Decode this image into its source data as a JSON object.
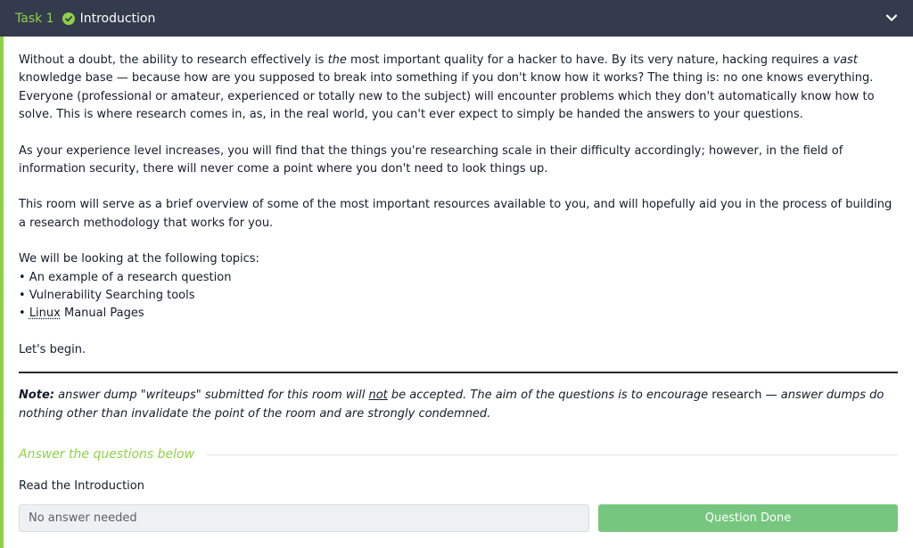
{
  "header": {
    "task_label": "Task 1",
    "title": "Introduction",
    "colors": {
      "bg": "#343b4d",
      "accent": "#8fd14a"
    },
    "icons": [
      "check-circle-icon",
      "chevron-down-icon"
    ]
  },
  "content": {
    "p1_a": "Without a doubt, the ability to research effectively is ",
    "p1_em1": "the",
    "p1_b": " most important quality for a hacker to have. By its very nature, hacking requires a ",
    "p1_em2": "vast",
    "p1_c": " knowledge base — because how are you supposed to break into something if you don't know how it works? The thing is: no one knows everything. Everyone (professional or amateur, experienced or totally new to the subject) will encounter problems which they don't automatically know how to solve. This is where research comes in, as, in the real world, you can't ever expect to simply be handed the answers to your questions.",
    "p2": "As your experience level increases, you will find that the things you're researching scale in their difficulty accordingly; however, in the field of information security, there will never come a point where you don't need to look things up.",
    "p3": "This room will serve as a brief overview of some of the most important resources available to you, and will hopefully aid you in the process of building a research methodology that works for you.",
    "p4_intro": "We will be looking at the following topics:",
    "topic1": "• An example of a research question",
    "topic2": "• Vulnerability Searching tools",
    "topic3_bullet": "• ",
    "topic3_linux": "Linux",
    "topic3_rest": " Manual Pages",
    "p5": "Let's begin."
  },
  "note": {
    "label": "Note:",
    "a": " answer dump \"writeups\" submitted for this room will ",
    "not": "not",
    "b": " be accepted. The aim of the questions is to encourage ",
    "research": "research",
    "c": " — answer dumps do nothing other than invalidate the point of the room and are strongly condemned."
  },
  "answers": {
    "heading": "Answer the questions below",
    "question": "Read the Introduction",
    "placeholder": "No answer needed",
    "button": "Question Done",
    "button_color": "#76c67f"
  }
}
